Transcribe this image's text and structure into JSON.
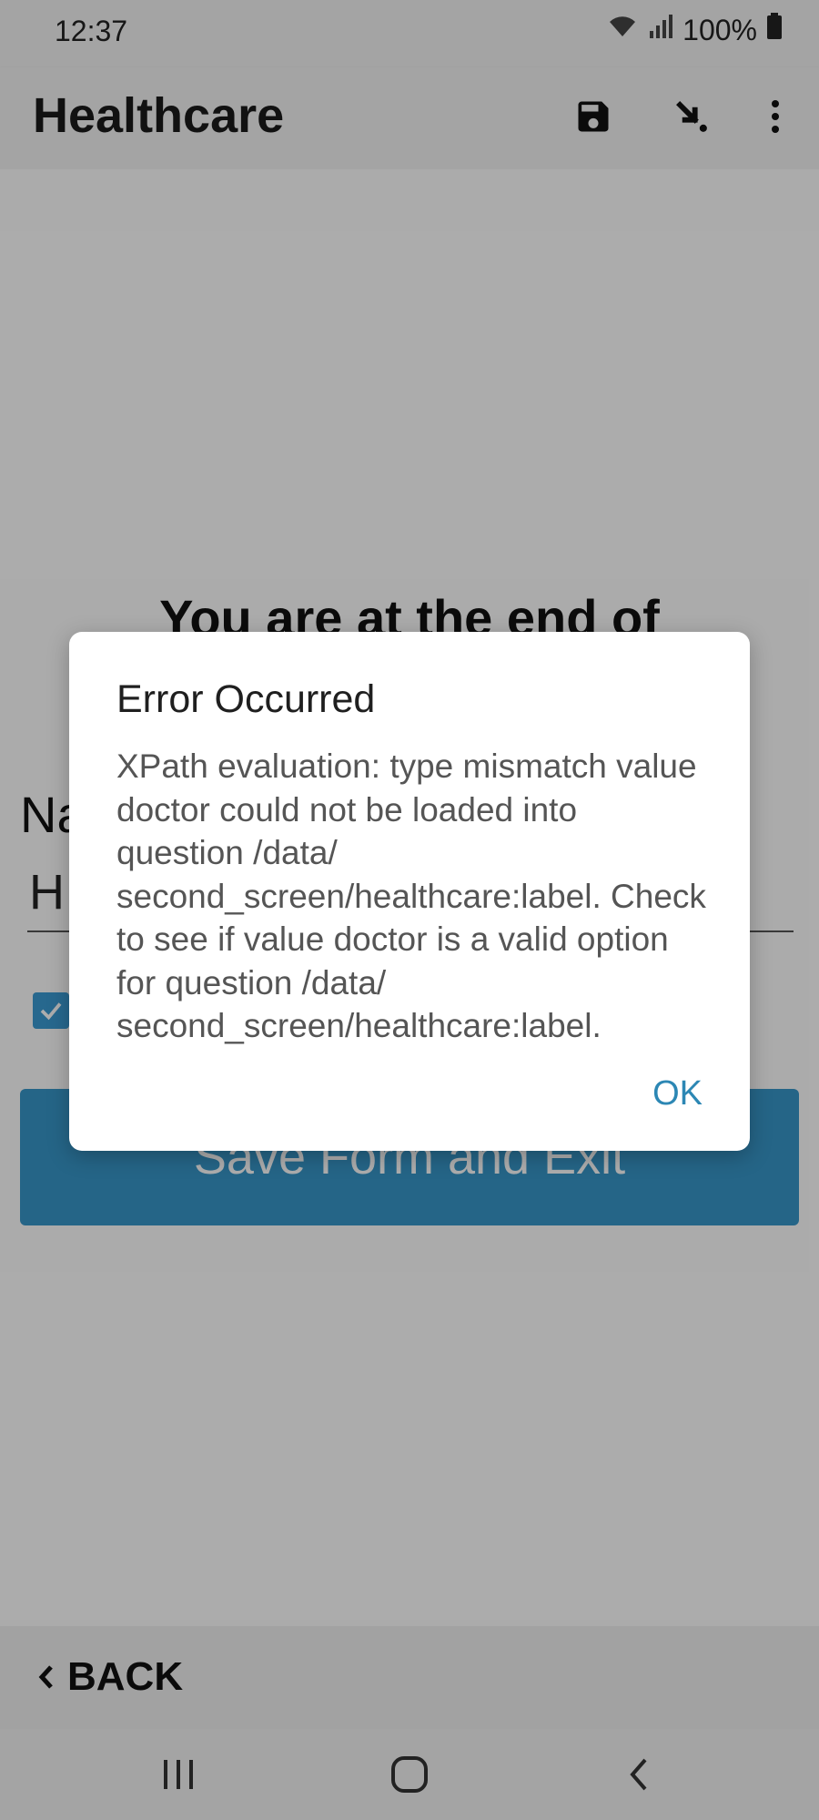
{
  "status_bar": {
    "time": "12:37",
    "battery": "100%"
  },
  "app_bar": {
    "title": "Healthcare",
    "icons": [
      "save-icon",
      "jump-to-question-icon",
      "more-options-icon"
    ]
  },
  "form_end": {
    "title": "You are at the end of",
    "name_label_fragment": "Na",
    "name_value_fragment": "H",
    "save_button_label": "Save Form and Exit"
  },
  "bottom_bar": {
    "back_label": "BACK"
  },
  "dialog": {
    "title": "Error Occurred",
    "message": "XPath evaluation: type mismatch value doctor could not be loaded into question /data/ second_screen/healthcare:label. Check to see if value doctor is a valid option for question /data/ second_screen/healthcare:label.",
    "ok_label": "OK"
  },
  "colors": {
    "accent": "#3796c7",
    "dialog_button": "#2c87b4",
    "scrim": "rgba(0,0,0,0.32)"
  }
}
